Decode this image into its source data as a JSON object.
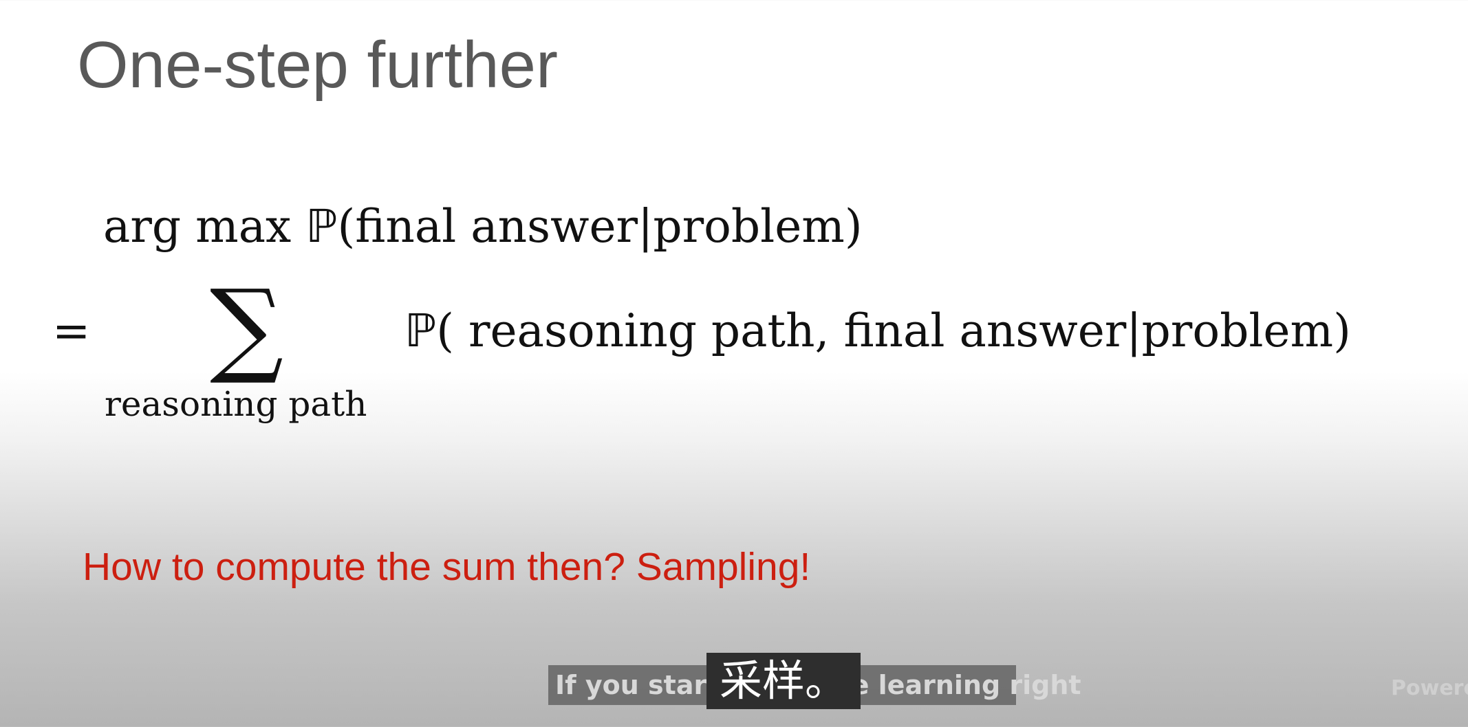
{
  "slide": {
    "title": "One-step further",
    "equation": {
      "line1_op": "arg max ",
      "line1_P": "ℙ",
      "line1_rest": "(final answer|problem)",
      "equals": "=",
      "sum_symbol": "∑",
      "sum_subscript": "reasoning path",
      "line2_P": "ℙ",
      "line2_rest": "( reasoning path, final answer|problem)"
    },
    "question": "How to compute the sum then?  Sampling!"
  },
  "captions": {
    "english": "If you start doing the learning right",
    "chinese": "采样。"
  },
  "watermark": "Powered"
}
